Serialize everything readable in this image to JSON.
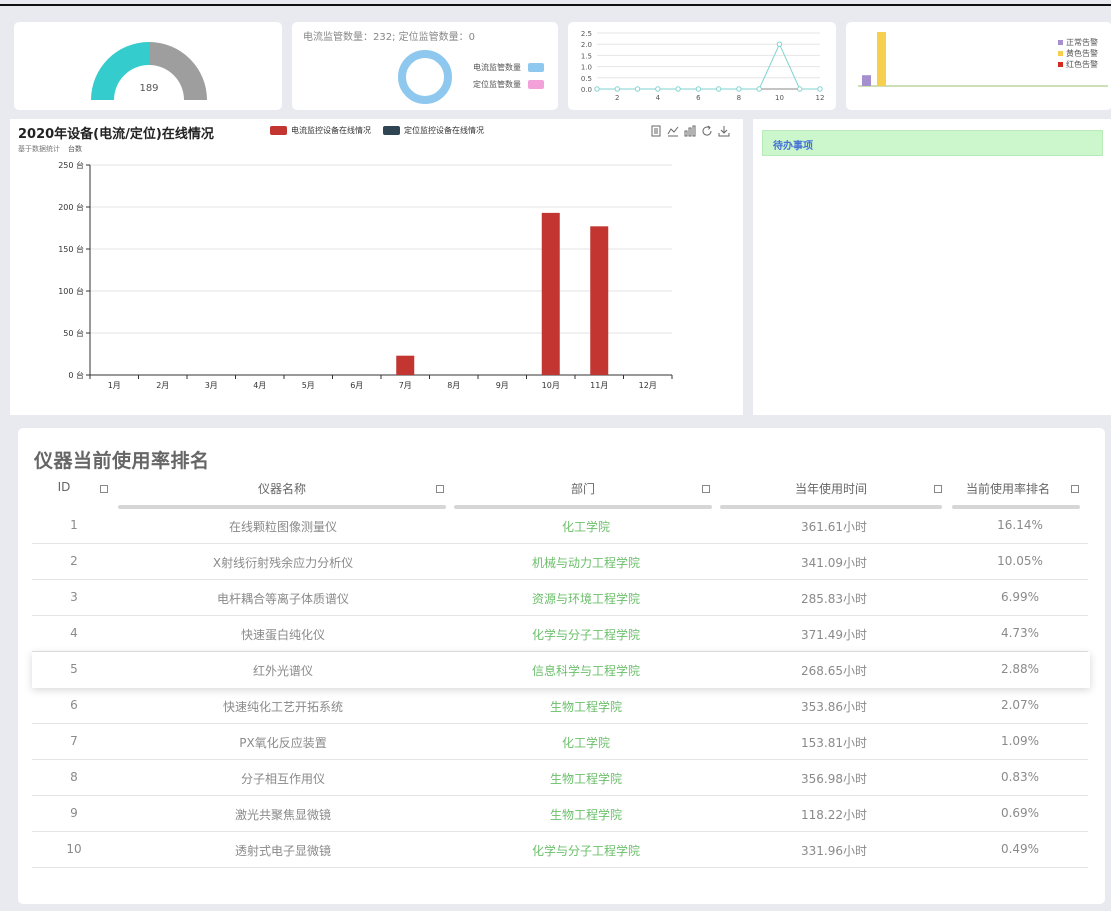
{
  "gauge": {
    "value": "189",
    "colors": {
      "fill": "#34cccc",
      "track": "#9e9e9e"
    }
  },
  "donut": {
    "summary": "电流监管数量：232; 定位监管数量：0",
    "legend": [
      {
        "label": "电流监管数量",
        "color": "#8ec8ee"
      },
      {
        "label": "定位监管数量",
        "color": "#f2a2d8"
      }
    ]
  },
  "mini_line": {
    "chart_data": {
      "type": "line",
      "x": [
        1,
        2,
        3,
        4,
        5,
        6,
        7,
        8,
        9,
        10,
        11,
        12
      ],
      "series": [
        {
          "values": [
            0,
            0,
            0,
            0,
            0,
            0,
            0,
            0,
            0,
            2,
            0,
            0
          ]
        }
      ],
      "xticks": [
        "2",
        "4",
        "6",
        "8",
        "10",
        "12"
      ],
      "yticks": [
        "0.0",
        "0.5",
        "1.0",
        "1.5",
        "2.0",
        "2.5"
      ],
      "ylim": [
        0,
        2.5
      ],
      "color": "#7fd3d1"
    }
  },
  "mini_bar": {
    "legend": [
      {
        "label": "正常告警",
        "color": "#a58fcf"
      },
      {
        "label": "黄色告警",
        "color": "#f6cf4f"
      },
      {
        "label": "红色告警",
        "color": "#d42b1e"
      }
    ],
    "chart_data": {
      "type": "bar",
      "series": [
        {
          "name": "正常告警",
          "values": [
            0.2
          ]
        },
        {
          "name": "黄色告警",
          "values": [
            1
          ]
        },
        {
          "name": "红色告警",
          "values": [
            0
          ]
        }
      ],
      "ylim": [
        0,
        1
      ]
    }
  },
  "main_chart": {
    "title": "2020年设备(电流/定位)在线情况",
    "subtitle": "基于数据统计",
    "unit": "台数",
    "legend": [
      {
        "label": "电流监控设备在线情况",
        "color": "#c23531"
      },
      {
        "label": "定位监控设备在线情况",
        "color": "#2f4554"
      }
    ],
    "chart_data": {
      "type": "bar",
      "categories": [
        "1月",
        "2月",
        "3月",
        "4月",
        "5月",
        "6月",
        "7月",
        "8月",
        "9月",
        "10月",
        "11月",
        "12月"
      ],
      "series": [
        {
          "name": "电流监控设备在线情况",
          "values": [
            0,
            0,
            0,
            0,
            0,
            0,
            23,
            0,
            0,
            193,
            177,
            0
          ]
        },
        {
          "name": "定位监控设备在线情况",
          "values": [
            0,
            0,
            0,
            0,
            0,
            0,
            0,
            0,
            0,
            0,
            0,
            0
          ]
        }
      ],
      "yticks": [
        "0 台",
        "50 台",
        "100 台",
        "150 台",
        "200 台",
        "250 台"
      ],
      "ylim": [
        0,
        250
      ]
    },
    "toolbox": [
      "data-view-icon",
      "line-chart-icon",
      "bar-chart-icon",
      "refresh-icon",
      "download-icon"
    ]
  },
  "todo": {
    "title": "待办事项"
  },
  "table": {
    "title": "仪器当前使用率排名",
    "headers": {
      "id": "ID",
      "name": "仪器名称",
      "dept": "部门",
      "hours": "当年使用时间",
      "rate": "当前使用率排名"
    },
    "rows": [
      {
        "id": "1",
        "name": "在线颗粒图像测量仪",
        "dept": "化工学院",
        "hours": "361.61小时",
        "rate": "16.14%"
      },
      {
        "id": "2",
        "name": "X射线衍射残余应力分析仪",
        "dept": "机械与动力工程学院",
        "hours": "341.09小时",
        "rate": "10.05%"
      },
      {
        "id": "3",
        "name": "电杆耦合等离子体质谱仪",
        "dept": "资源与环境工程学院",
        "hours": "285.83小时",
        "rate": "6.99%"
      },
      {
        "id": "4",
        "name": "快速蛋白纯化仪",
        "dept": "化学与分子工程学院",
        "hours": "371.49小时",
        "rate": "4.73%"
      },
      {
        "id": "5",
        "name": "红外光谱仪",
        "dept": "信息科学与工程学院",
        "hours": "268.65小时",
        "rate": "2.88%"
      },
      {
        "id": "6",
        "name": "快速纯化工艺开拓系统",
        "dept": "生物工程学院",
        "hours": "353.86小时",
        "rate": "2.07%"
      },
      {
        "id": "7",
        "name": "PX氧化反应装置",
        "dept": "化工学院",
        "hours": "153.81小时",
        "rate": "1.09%"
      },
      {
        "id": "8",
        "name": "分子相互作用仪",
        "dept": "生物工程学院",
        "hours": "356.98小时",
        "rate": "0.83%"
      },
      {
        "id": "9",
        "name": "激光共聚焦显微镜",
        "dept": "生物工程学院",
        "hours": "118.22小时",
        "rate": "0.69%"
      },
      {
        "id": "10",
        "name": "透射式电子显微镜",
        "dept": "化学与分子工程学院",
        "hours": "331.96小时",
        "rate": "0.49%"
      }
    ],
    "active_row": 4
  }
}
